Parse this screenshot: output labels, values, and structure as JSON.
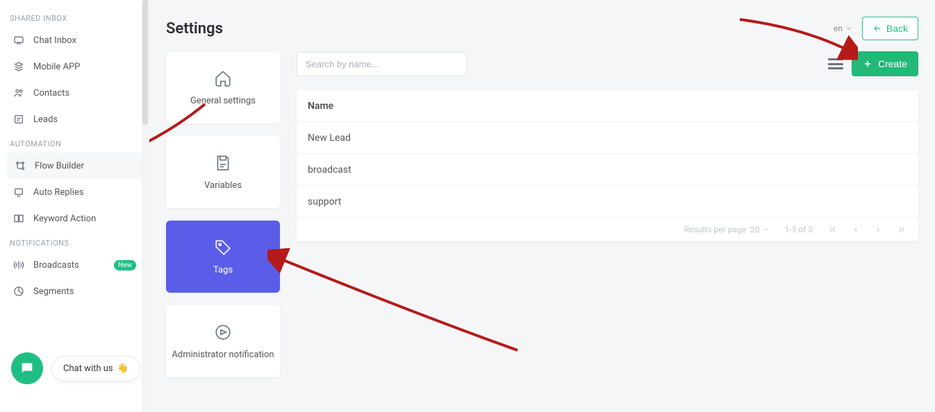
{
  "sidebar": {
    "sections": [
      {
        "label": "SHARED INBOX",
        "items": [
          {
            "label": "Chat Inbox"
          },
          {
            "label": "Mobile APP"
          },
          {
            "label": "Contacts"
          },
          {
            "label": "Leads"
          }
        ]
      },
      {
        "label": "AUTOMATION",
        "items": [
          {
            "label": "Flow Builder"
          },
          {
            "label": "Auto Replies"
          },
          {
            "label": "Keyword Action"
          }
        ]
      },
      {
        "label": "NOTIFICATIONS",
        "items": [
          {
            "label": "Broadcasts",
            "badge": "New"
          },
          {
            "label": "Segments"
          }
        ]
      }
    ]
  },
  "chat_widget": {
    "label": "Chat with us",
    "emoji": "👋"
  },
  "header": {
    "title": "Settings",
    "lang": "en",
    "back_label": "Back"
  },
  "tiles": {
    "general": "General settings",
    "variables": "Variables",
    "tags": "Tags",
    "admin_notification": "Administrator notification"
  },
  "toolbar": {
    "search_placeholder": "Search by name...",
    "create_label": "Create"
  },
  "table": {
    "header": "Name",
    "rows": [
      "New Lead",
      "broadcast",
      "support"
    ],
    "results_label": "Results per page",
    "page_size": "20",
    "range_label": "1-3 of 3"
  }
}
